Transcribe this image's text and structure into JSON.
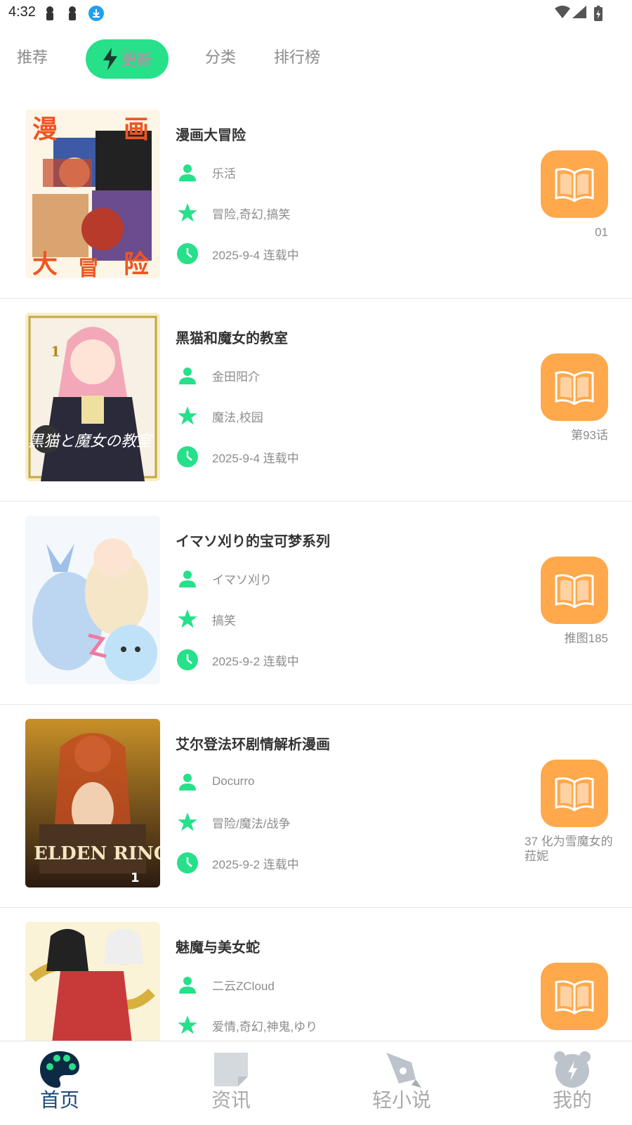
{
  "status_bar": {
    "time": "4:32"
  },
  "tabs": [
    {
      "label": "推荐"
    },
    {
      "label": "更新"
    },
    {
      "label": "分类"
    },
    {
      "label": "排行榜"
    }
  ],
  "colors": {
    "accent": "#26e08a",
    "read_button": "#ffa84c",
    "nav_active": "#1a4a7c"
  },
  "icons": {
    "author": "person-icon",
    "tags": "star-icon",
    "date": "clock-icon",
    "read": "open-book-icon"
  },
  "items": [
    {
      "title": "漫画大冒险",
      "author": "乐活",
      "tags": "冒险,奇幻,搞笑",
      "date": "2025-9-4 连载中",
      "chapter": "01"
    },
    {
      "title": "黑猫和魔女的教室",
      "author": "金田阳介",
      "tags": "魔法,校园",
      "date": "2025-9-4 连载中",
      "chapter": "第93话"
    },
    {
      "title": "イマソ刈り的宝可梦系列",
      "author": "イマソ刈り",
      "tags": "搞笑",
      "date": "2025-9-2 连载中",
      "chapter": "推图185"
    },
    {
      "title": "艾尔登法环剧情解析漫画",
      "author": "Docurro",
      "tags": "冒险/魔法/战争",
      "date": "2025-9-2 连载中",
      "chapter": "37 化为雪魔女的菈妮"
    },
    {
      "title": "魅魔与美女蛇",
      "author": "二云ZCloud",
      "tags": "爱情,奇幻,神鬼,ゆり",
      "date": "",
      "chapter": ""
    }
  ],
  "bottom_nav": [
    {
      "label": "首页"
    },
    {
      "label": "资讯"
    },
    {
      "label": "轻小说"
    },
    {
      "label": "我的"
    }
  ]
}
